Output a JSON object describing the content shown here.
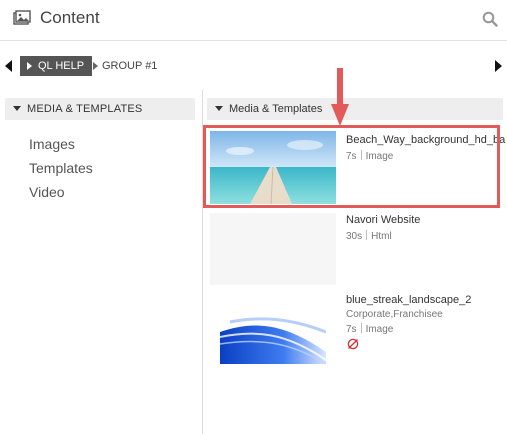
{
  "header": {
    "title": "Content",
    "header_icon": "image-icon",
    "search_icon": "search-icon"
  },
  "breadcrumb": {
    "active": "QL HELP",
    "next": "GROUP #1"
  },
  "left_panel": {
    "heading": "MEDIA & TEMPLATES",
    "items": [
      {
        "label": "Images"
      },
      {
        "label": "Templates"
      },
      {
        "label": "Video"
      }
    ]
  },
  "right_panel": {
    "heading": "Media & Templates",
    "items": [
      {
        "name": "Beach_Way_background_hd_ba",
        "duration": "7s",
        "type": "Image",
        "tags": ""
      },
      {
        "name": "Navori Website",
        "duration": "30s",
        "type": "Html",
        "tags": ""
      },
      {
        "name": "blue_streak_landscape_2",
        "duration": "7s",
        "type": "Image",
        "tags": "Corporate,Franchisee"
      }
    ]
  },
  "colors": {
    "highlight": "#e35a5a",
    "active_crumb": "#555555"
  }
}
